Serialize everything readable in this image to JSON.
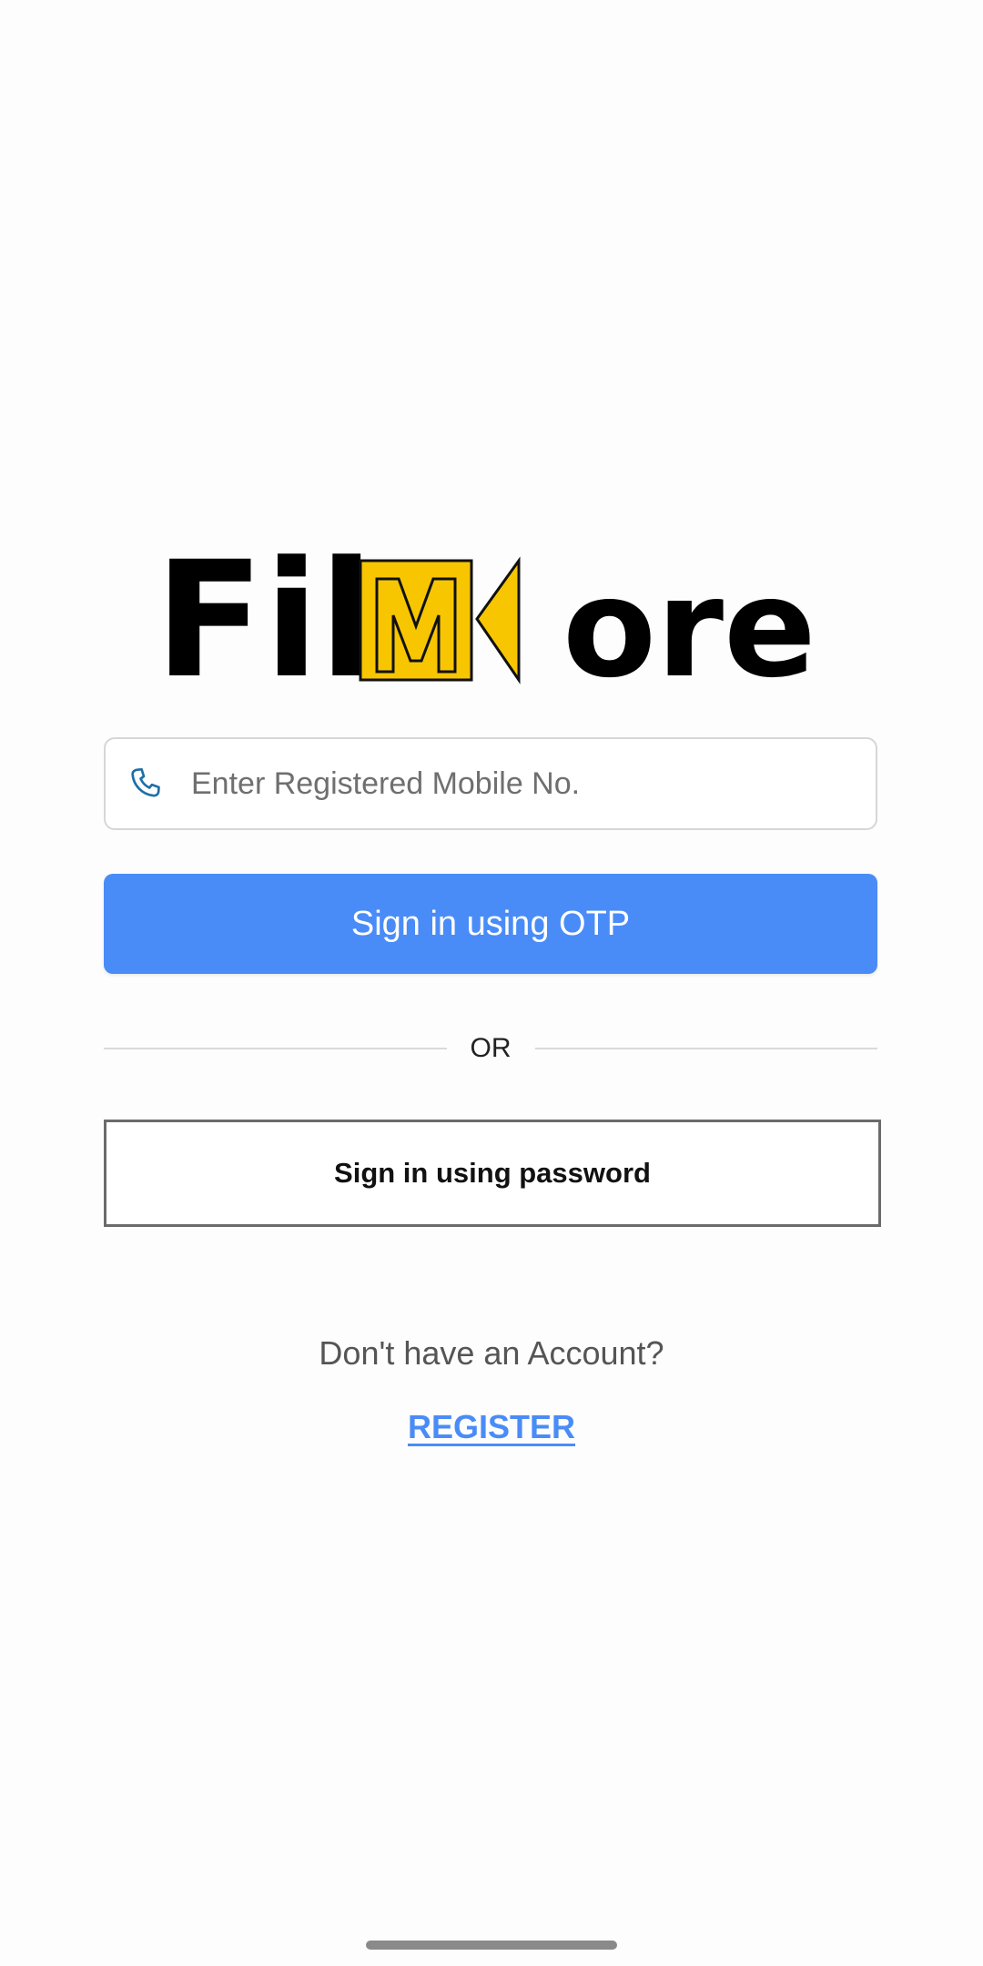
{
  "logo": {
    "text_before": "Fil",
    "text_highlight": "M",
    "text_after": "ore",
    "accent_color": "#f7c600",
    "ink_color": "#000000"
  },
  "login": {
    "phone_icon": "phone-icon",
    "phone_placeholder": "Enter Registered Mobile No.",
    "phone_value": "",
    "otp_button_label": "Sign in using OTP",
    "divider_label": "OR",
    "password_button_label": "Sign in using password",
    "account_prompt": "Don't have an Account?",
    "register_label": "REGISTER"
  },
  "colors": {
    "primary": "#4a8cf7",
    "phone_icon": "#1e6fa8",
    "border": "#d6d6d6"
  }
}
